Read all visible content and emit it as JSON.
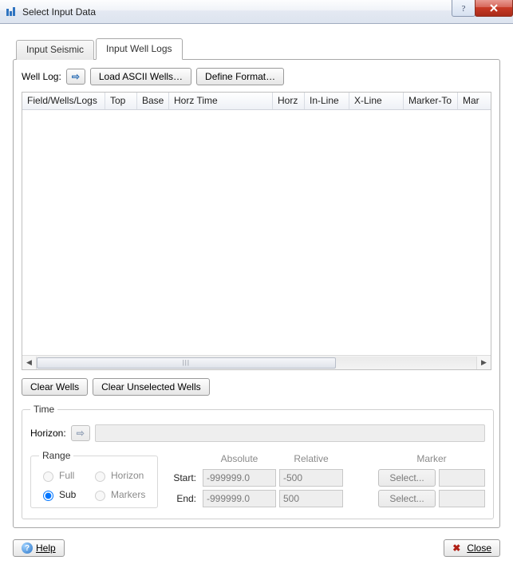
{
  "window": {
    "title": "Select Input Data"
  },
  "tabs": [
    {
      "label": "Input Seismic",
      "active": false
    },
    {
      "label": "Input Well Logs",
      "active": true
    }
  ],
  "wellLog": {
    "label": "Well Log:",
    "loadButton": "Load ASCII Wells…",
    "defineFormatButton": "Define Format…"
  },
  "table": {
    "columns": [
      "Field/Wells/Logs",
      "Top",
      "Base",
      "Horz Time",
      "Horz",
      "In-Line",
      "X-Line",
      "Marker-To",
      "Mar"
    ]
  },
  "buttons": {
    "clearWells": "Clear Wells",
    "clearUnselected": "Clear Unselected Wells"
  },
  "time": {
    "legend": "Time",
    "horizonLabel": "Horizon:",
    "range": {
      "legend": "Range",
      "options": {
        "full": "Full",
        "horizon": "Horizon",
        "sub": "Sub",
        "markers": "Markers"
      },
      "selected": "sub"
    },
    "headers": {
      "absolute": "Absolute",
      "relative": "Relative",
      "marker": "Marker"
    },
    "start": {
      "label": "Start:",
      "absolute": "-999999.0",
      "relative": "-500",
      "select": "Select..."
    },
    "end": {
      "label": "End:",
      "absolute": "-999999.0",
      "relative": "500",
      "select": "Select..."
    }
  },
  "footer": {
    "help": "Help",
    "close": "Close"
  }
}
